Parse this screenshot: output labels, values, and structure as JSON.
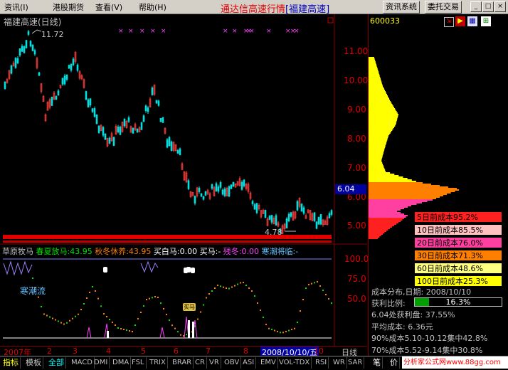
{
  "menubar": {
    "menus": [
      "资讯(I)",
      "港股期货",
      "查看(V)",
      "帮助(H)"
    ],
    "title": "通达信高速行情",
    "title_tag": "[福建高速]",
    "buttons": [
      "资讯系统",
      "委托交易"
    ],
    "window_buttons": [
      "_",
      "□",
      "×"
    ]
  },
  "main_chart": {
    "title": "福建高速(日线)",
    "high_label": "11.72",
    "low_label": "4.78",
    "price_axis": [
      "11.00",
      "10.00",
      "9.00",
      "8.00",
      "7.00",
      "6.00",
      "5.00"
    ],
    "current_price": "6.04"
  },
  "indicator": {
    "name": "草原牧马",
    "labels": [
      {
        "text": "春夏放马:43.95",
        "color": "#00e000"
      },
      {
        "text": "秋冬休养:43.95",
        "color": "#ff8000"
      },
      {
        "text": "买白马:0.00",
        "color": "#ffffff"
      },
      {
        "text": "买马:-",
        "color": "#ffffff"
      },
      {
        "text": "残冬:0.00",
        "color": "#ff40ff"
      },
      {
        "text": "寒潮将临:-",
        "color": "#60c0ff"
      }
    ],
    "axis": [
      "100.0",
      "75.0",
      "50.0"
    ],
    "left_text": "寒潮流",
    "marker_text": "买马"
  },
  "date_axis": {
    "labels": [
      "2007年",
      "2",
      "3",
      "4",
      "5",
      "6",
      "7",
      "8",
      "9",
      "10"
    ],
    "cursor_date": "2008/10/10/五",
    "period": "日线"
  },
  "right_panel": {
    "code": "600033",
    "cost_rows": [
      {
        "label": "5日前成本95.2%",
        "color": "#ff2020"
      },
      {
        "label": "10日前成本85.5%",
        "color": "#ffc0c0"
      },
      {
        "label": "20日前成本76.0%",
        "color": "#ff40a0"
      },
      {
        "label": "30日前成本71.3%",
        "color": "#ff8000"
      },
      {
        "label": "60日前成本48.6%",
        "color": "#ffff80"
      },
      {
        "label": "100日前成本25.3%",
        "color": "#ffff00"
      }
    ],
    "info": {
      "dist_date": "成本分布,日期: 2008/10/10",
      "profit_label": "获利比例:",
      "profit_value": "16.3%",
      "profit_fraction": 0.163,
      "profit_at": "6.04处获利盘: 37.55%",
      "avg_cost": "平均成本: 6.36元",
      "cost90": "90%成本5.10-10.12集中42.8%",
      "cost70": "70%成本5.52-9.14集中30.8%"
    },
    "bottom_tabs": [
      "笔",
      "价"
    ],
    "watermark": "分析家公式网www.88gg.com"
  },
  "bottom_tabs": [
    "指标",
    "模板",
    "全部",
    "MACD",
    "DMI",
    "DMA",
    "FSL",
    "TRIX",
    "BRAR",
    "CR",
    "VR",
    "OBV",
    "ASI",
    "EMV",
    "VOL-TDX",
    "RSI",
    "WR",
    "SAR"
  ]
}
